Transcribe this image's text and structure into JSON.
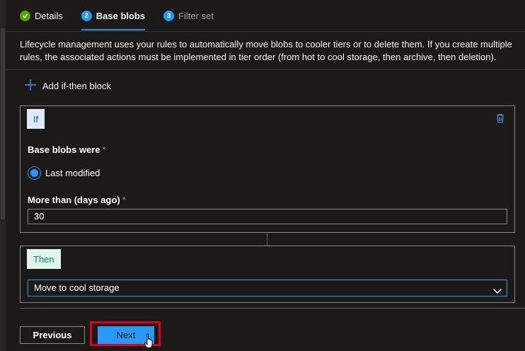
{
  "tabs": [
    {
      "label": "Details",
      "state": "completed",
      "icon": "checkmark-icon"
    },
    {
      "number": "2",
      "label": "Base blobs",
      "state": "active"
    },
    {
      "number": "3",
      "label": "Filter set",
      "state": "disabled"
    }
  ],
  "description": "Lifecycle management uses your rules to automatically move blobs to cooler tiers or to delete them. If you create multiple rules, the associated actions must be implemented in tier order (from hot to cool storage, then archive, then deletion).",
  "add_block_label": "Add if-then block",
  "if_block": {
    "chip_label": "If",
    "base_blobs_label": "Base blobs were",
    "required_marker": "*",
    "radio_option": "Last modified",
    "radio_selected": true,
    "days_label": "More than (days ago)",
    "days_value": "30"
  },
  "then_block": {
    "chip_label": "Then",
    "action_value": "Move to cool storage"
  },
  "footer": {
    "previous_label": "Previous",
    "next_label": "Next"
  },
  "colors": {
    "accent": "#2899f5",
    "success": "#57a300",
    "required": "#f1707b",
    "highlight": "#e0001a"
  }
}
